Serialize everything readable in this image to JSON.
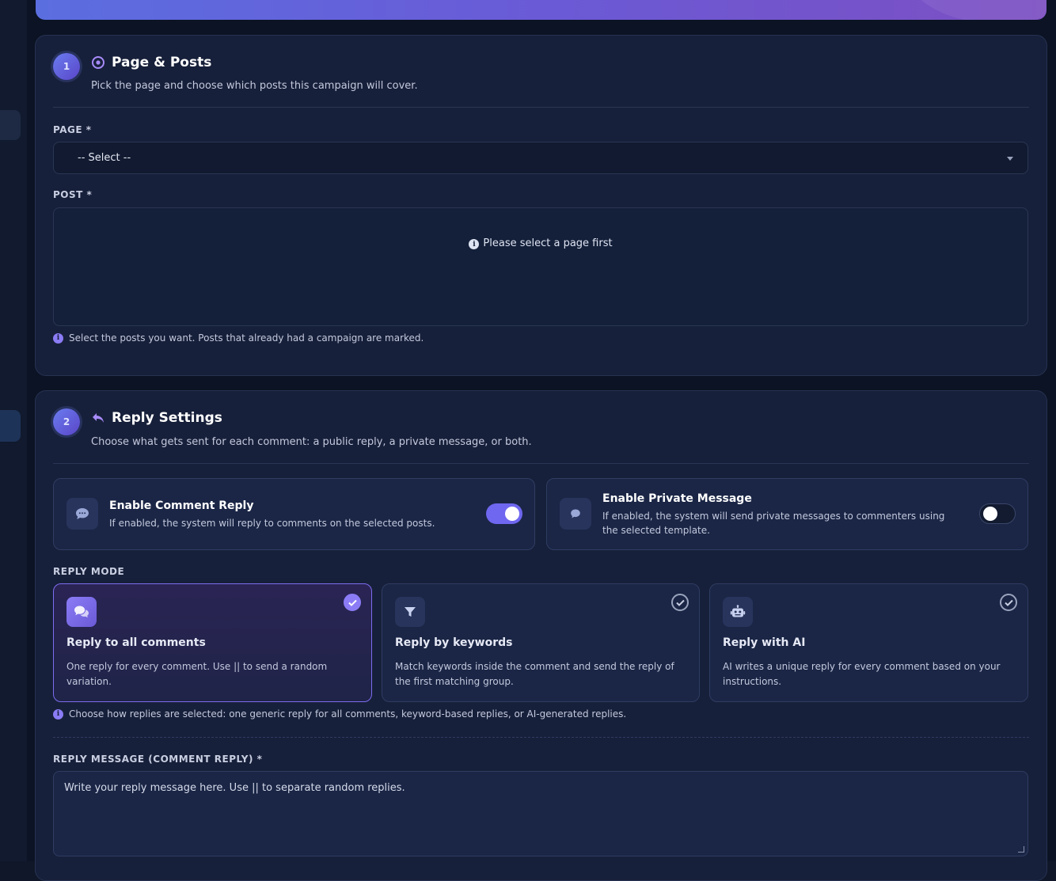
{
  "section1": {
    "step": "1",
    "title": "Page & Posts",
    "subtitle": "Pick the page and choose which posts this campaign will cover.",
    "page_label": "PAGE *",
    "page_select_value": "-- Select --",
    "post_label": "POST *",
    "post_placeholder": "Please select a page first",
    "post_hint": "Select the posts you want. Posts that already had a campaign are marked."
  },
  "section2": {
    "step": "2",
    "title": "Reply Settings",
    "subtitle": "Choose what gets sent for each comment: a public reply, a private message, or both.",
    "comment_reply": {
      "title": "Enable Comment Reply",
      "desc": "If enabled, the system will reply to comments on the selected posts.",
      "enabled": true
    },
    "private_message": {
      "title": "Enable Private Message",
      "desc": "If enabled, the system will send private messages to commenters using the selected template.",
      "enabled": false
    },
    "reply_mode_label": "REPLY MODE",
    "modes": [
      {
        "title": "Reply to all comments",
        "desc": "One reply for every comment. Use || to send a random variation.",
        "icon": "comments-icon",
        "selected": true
      },
      {
        "title": "Reply by keywords",
        "desc": "Match keywords inside the comment and send the reply of the first matching group.",
        "icon": "filter-icon",
        "selected": false
      },
      {
        "title": "Reply with AI",
        "desc": "AI writes a unique reply for every comment based on your instructions.",
        "icon": "robot-icon",
        "selected": false
      }
    ],
    "mode_hint": "Choose how replies are selected: one generic reply for all comments, keyword-based replies, or AI-generated replies.",
    "reply_message_label": "REPLY MESSAGE (COMMENT REPLY) *",
    "reply_message_placeholder": "Write your reply message here. Use || to separate random replies."
  },
  "colors": {
    "accent": "#8b7cf6",
    "card_bg": "#17203a",
    "page_bg": "#0b1324"
  }
}
